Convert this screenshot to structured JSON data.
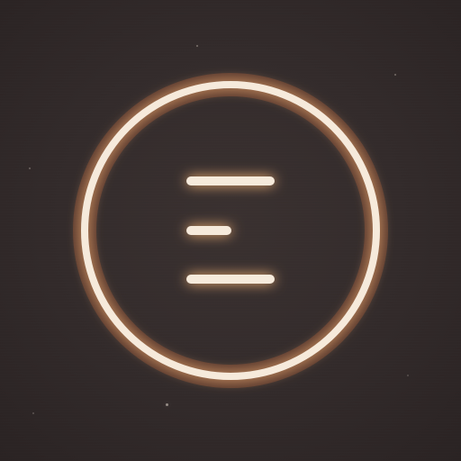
{
  "app_icon": {
    "background_color": "#332b2b",
    "ring_color": "#f6eadb",
    "glow_color": "#ff7a3d",
    "icon_name": "menu-lines-icon"
  }
}
